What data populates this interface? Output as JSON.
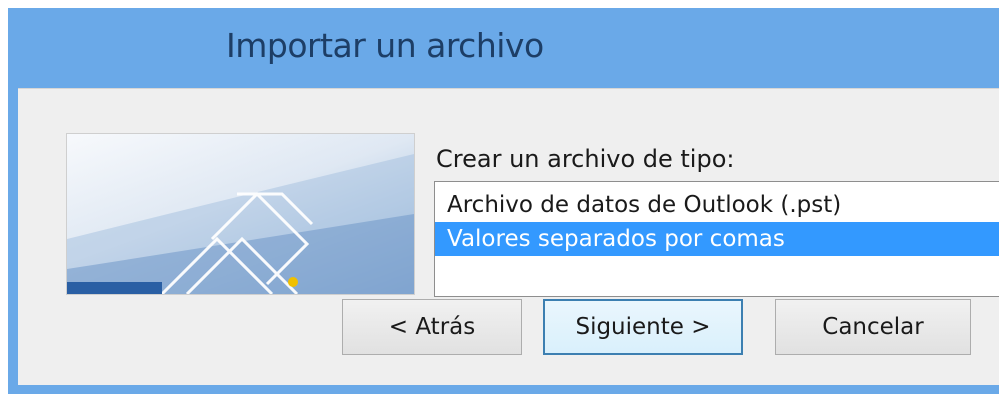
{
  "dialog": {
    "title": "Importar un archivo"
  },
  "file_type": {
    "label": "Crear un archivo de tipo:",
    "options": [
      {
        "label": "Archivo de datos de Outlook (.pst)",
        "selected": false
      },
      {
        "label": "Valores separados por comas",
        "selected": true
      }
    ]
  },
  "buttons": {
    "back": "< Atrás",
    "next": "Siguiente >",
    "cancel": "Cancelar"
  },
  "colors": {
    "titlebar": "#6aa9e8",
    "selection": "#3399ff",
    "title_text": "#1d3e66"
  },
  "icons": {
    "wizard_graphic": "import-wizard-graphic"
  }
}
